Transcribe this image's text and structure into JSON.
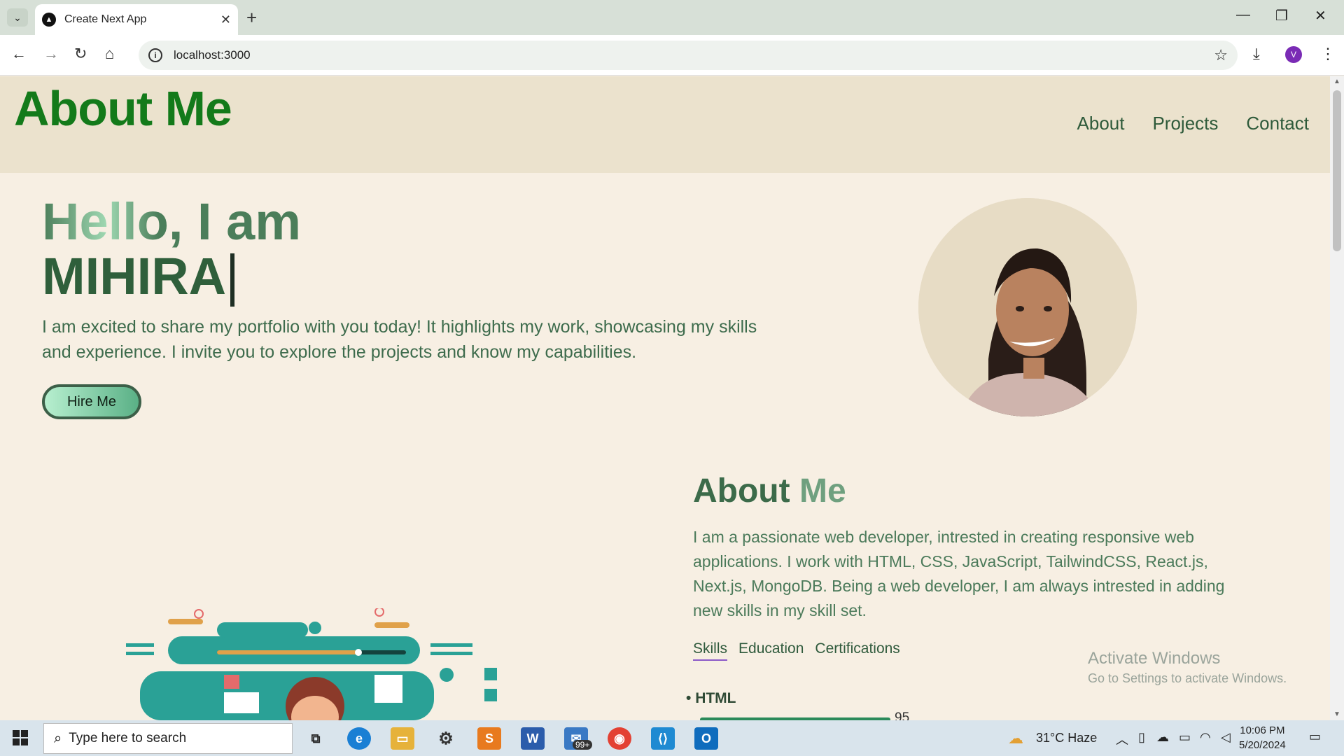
{
  "browser": {
    "tab_title": "Create Next App",
    "url": "localhost:3000",
    "profile_initial": "V"
  },
  "site": {
    "logo": "About Me",
    "nav": [
      "About",
      "Projects",
      "Contact"
    ]
  },
  "hero": {
    "greeting": "Hello, I am",
    "name": "MIHIRA",
    "intro": "I am excited to share my portfolio with you today! It highlights my work, showcasing my skills and experience. I invite you to explore the projects and know my capabilities.",
    "cta": "Hire Me"
  },
  "about": {
    "title_1": "About",
    "title_2": "Me",
    "text": "I am a passionate web developer, intrested in creating responsive web applications. I work with HTML, CSS, JavaScript, TailwindCSS, React.js, Next.js, MongoDB. Being a web developer, I am always intrested in adding new skills in my skill set.",
    "tabs": [
      "Skills",
      "Education",
      "Certifications"
    ],
    "skills": [
      {
        "name": "HTML",
        "percent": "95"
      }
    ]
  },
  "watermark": {
    "line1": "Activate Windows",
    "line2": "Go to Settings to activate Windows."
  },
  "taskbar": {
    "search_placeholder": "Type here to search",
    "mail_badge": "99+",
    "weather": "31°C  Haze",
    "time": "10:06 PM",
    "date": "5/20/2024"
  }
}
